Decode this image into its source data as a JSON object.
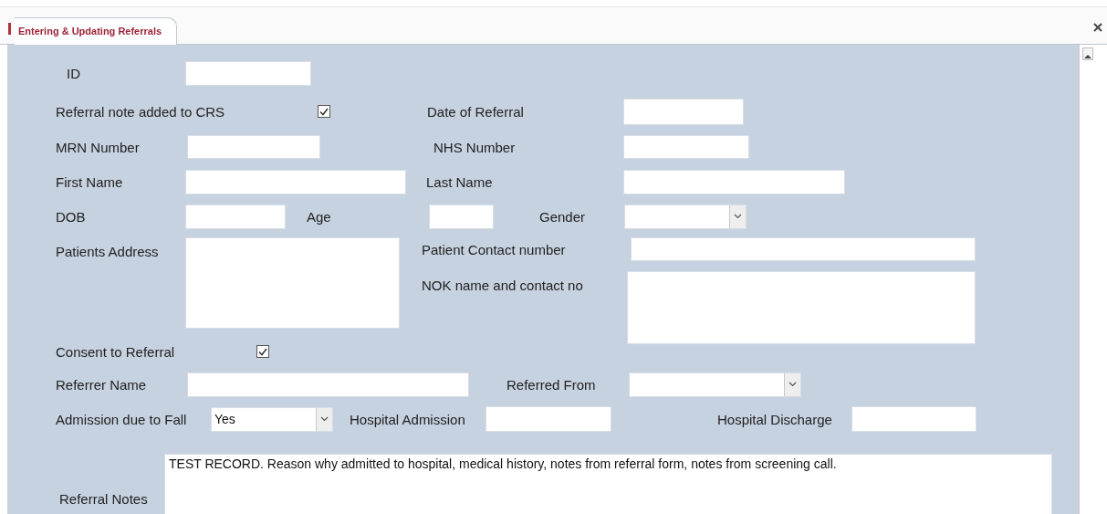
{
  "tab": {
    "label": "Entering & Updating Referrals",
    "selected": true
  },
  "rows": [
    {
      "items": [
        {
          "kind": "label",
          "text": "ID"
        },
        {
          "kind": "field"
        }
      ]
    },
    {
      "items": [
        {
          "kind": "label",
          "text": "Referral note added to CRS"
        },
        {
          "kind": "checkbox",
          "checked": true
        },
        {
          "kind": "label",
          "text": "Date of Referral"
        },
        {
          "kind": "field"
        }
      ]
    },
    {
      "items": [
        {
          "kind": "label",
          "text": "MRN Number"
        },
        {
          "kind": "field"
        },
        {
          "kind": "label",
          "text": "NHS Number"
        },
        {
          "kind": "field"
        }
      ]
    },
    {
      "items": [
        {
          "kind": "label",
          "text": "First Name"
        },
        {
          "kind": "field"
        },
        {
          "kind": "label",
          "text": "Last Name"
        },
        {
          "kind": "field"
        }
      ]
    },
    {
      "items": [
        {
          "kind": "label",
          "text": "DOB"
        },
        {
          "kind": "field"
        },
        {
          "kind": "label",
          "text": "Age"
        },
        {
          "kind": "field"
        },
        {
          "kind": "label",
          "text": "Gender"
        },
        {
          "kind": "combo"
        }
      ]
    },
    {
      "items": [
        {
          "kind": "label",
          "text": "Patients Address"
        },
        {
          "kind": "memo"
        },
        {
          "kind": "group",
          "rows": [
            {
              "items": [
                {
                  "kind": "label",
                  "text": "Patient Contact number"
                },
                {
                  "kind": "field"
                }
              ]
            },
            {
              "items": [
                {
                  "kind": "label",
                  "text": "NOK name and contact no"
                },
                {
                  "kind": "memo"
                }
              ]
            }
          ]
        }
      ]
    },
    {
      "items": [
        {
          "kind": "label",
          "text": "Consent to Referral"
        },
        {
          "kind": "checkbox",
          "checked": true
        }
      ]
    },
    {
      "items": [
        {
          "kind": "label",
          "text": "Referrer Name"
        },
        {
          "kind": "field"
        },
        {
          "kind": "label",
          "text": "Referred From"
        },
        {
          "kind": "combo"
        }
      ]
    },
    {
      "items": [
        {
          "kind": "label",
          "text": "Admission due to Fall"
        },
        {
          "kind": "combo",
          "value": "Yes"
        },
        {
          "kind": "label",
          "text": "Hospital Admission"
        },
        {
          "kind": "field"
        },
        {
          "kind": "label",
          "text": "Hospital Discharge"
        },
        {
          "kind": "field"
        }
      ]
    },
    {
      "items": [
        {
          "kind": "label",
          "text": "Referral Notes"
        },
        {
          "kind": "memo",
          "value": "TEST RECORD. Reason why admitted to hospital, medical history, notes from referral form, notes from screening call."
        }
      ]
    }
  ]
}
